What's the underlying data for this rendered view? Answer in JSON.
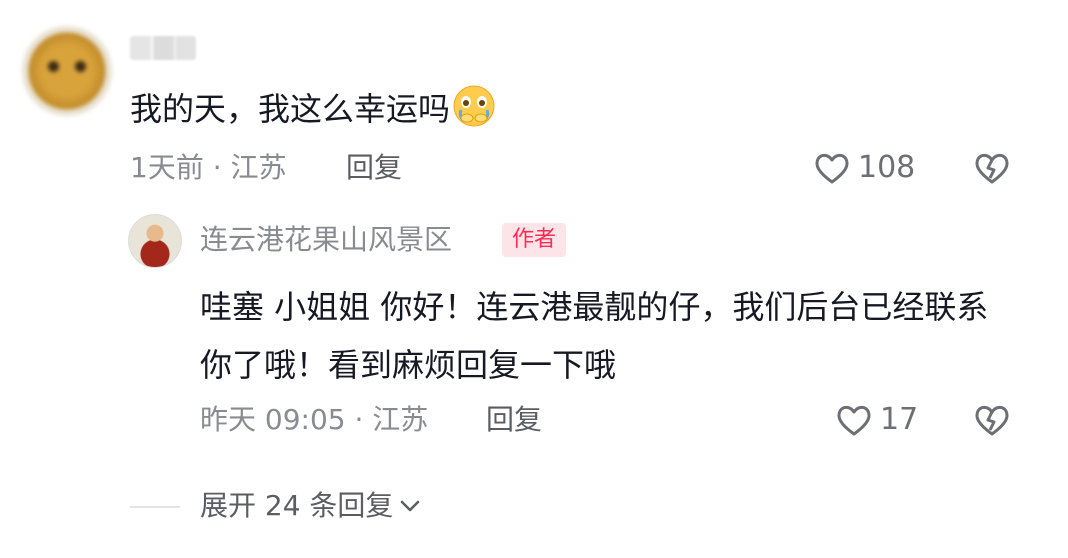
{
  "comment": {
    "text": "我的天，我这么幸运吗",
    "emoji": "crying-face-emoji",
    "meta": "1天前 · 江苏",
    "reply_label": "回复",
    "likes": "108"
  },
  "reply": {
    "author": "连云港花果山风景区",
    "badge": "作者",
    "text": "哇塞 小姐姐 你好！连云港最靓的仔，我们后台已经联系你了哦！看到麻烦回复一下哦",
    "meta": "昨天 09:05 · 江苏",
    "reply_label": "回复",
    "likes": "17"
  },
  "expand": {
    "label": "展开 24 条回复"
  },
  "colors": {
    "text": "#161823",
    "muted": "#8a8b91",
    "badge_bg": "#fde4e8",
    "badge_fg": "#fe2c55"
  }
}
